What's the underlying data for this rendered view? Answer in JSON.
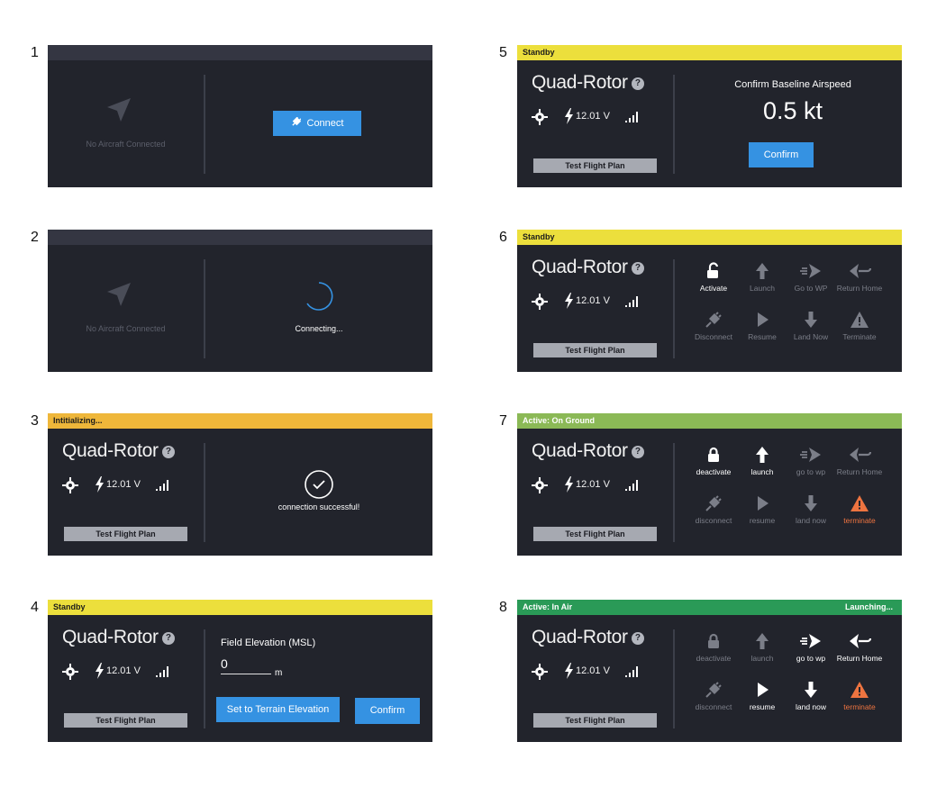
{
  "steps": [
    "1",
    "2",
    "3",
    "4",
    "5",
    "6",
    "7",
    "8"
  ],
  "common": {
    "aircraft_name": "Quad-Rotor",
    "help_glyph": "?",
    "voltage": "12.01 V",
    "flight_plan": "Test Flight Plan",
    "no_aircraft": "No Aircraft Connected"
  },
  "panel1": {
    "connect_label": "Connect"
  },
  "panel2": {
    "connecting_label": "Connecting..."
  },
  "panel3": {
    "status": "Intitializing...",
    "success_label": "connection successful!"
  },
  "panel4": {
    "status": "Standby",
    "field_label": "Field Elevation (MSL)",
    "elevation_value": "0",
    "unit": "m",
    "terrain_button": "Set to Terrain Elevation",
    "confirm_button": "Confirm"
  },
  "panel5": {
    "status": "Standby",
    "heading": "Confirm Baseline Airspeed",
    "airspeed": "0.5 kt",
    "confirm_button": "Confirm"
  },
  "panel6": {
    "status": "Standby",
    "commands": [
      {
        "label": "Activate",
        "icon": "unlock-icon",
        "state": "on"
      },
      {
        "label": "Launch",
        "icon": "arrow-up-icon",
        "state": "dim"
      },
      {
        "label": "Go to WP",
        "icon": "goto-wp-icon",
        "state": "dim"
      },
      {
        "label": "Return Home",
        "icon": "return-home-icon",
        "state": "dim"
      },
      {
        "label": "Disconnect",
        "icon": "plug-icon",
        "state": "dim"
      },
      {
        "label": "Resume",
        "icon": "play-icon",
        "state": "dim"
      },
      {
        "label": "Land Now",
        "icon": "arrow-down-icon",
        "state": "dim"
      },
      {
        "label": "Terminate",
        "icon": "warning-icon",
        "state": "dim"
      }
    ]
  },
  "panel7": {
    "status": "Active: On Ground",
    "commands": [
      {
        "label": "deactivate",
        "icon": "lock-icon",
        "state": "on"
      },
      {
        "label": "launch",
        "icon": "arrow-up-icon",
        "state": "on"
      },
      {
        "label": "go to wp",
        "icon": "goto-wp-icon",
        "state": "dim"
      },
      {
        "label": "Return Home",
        "icon": "return-home-icon",
        "state": "dim"
      },
      {
        "label": "disconnect",
        "icon": "plug-icon",
        "state": "dim"
      },
      {
        "label": "resume",
        "icon": "play-icon",
        "state": "dim"
      },
      {
        "label": "land now",
        "icon": "arrow-down-icon",
        "state": "dim"
      },
      {
        "label": "terminate",
        "icon": "warning-icon",
        "state": "warn"
      }
    ]
  },
  "panel8": {
    "status": "Active: In Air",
    "status_right": "Launching...",
    "commands": [
      {
        "label": "deactivate",
        "icon": "lock-icon",
        "state": "dim"
      },
      {
        "label": "launch",
        "icon": "arrow-up-icon",
        "state": "dim"
      },
      {
        "label": "go to wp",
        "icon": "goto-wp-icon",
        "state": "on"
      },
      {
        "label": "Return Home",
        "icon": "return-home-icon",
        "state": "on"
      },
      {
        "label": "disconnect",
        "icon": "plug-icon",
        "state": "dim"
      },
      {
        "label": "resume",
        "icon": "play-icon",
        "state": "on"
      },
      {
        "label": "land now",
        "icon": "arrow-down-icon",
        "state": "on"
      },
      {
        "label": "terminate",
        "icon": "warning-icon",
        "state": "warn"
      }
    ]
  },
  "colors": {
    "panel_bg": "#22242c",
    "standby": "#ecdf3c",
    "initializing": "#efb73a",
    "active_ground": "#8bb956",
    "active_air": "#2a9a57",
    "accent": "#3592e2",
    "terminate": "#ee7440"
  }
}
